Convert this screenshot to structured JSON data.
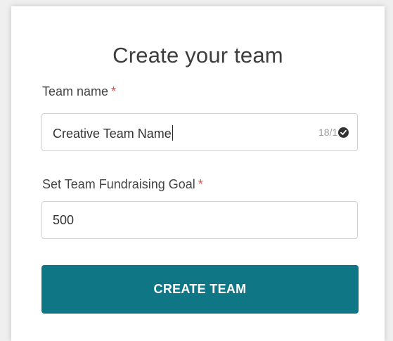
{
  "form": {
    "title": "Create your team",
    "team_name": {
      "label": "Team name",
      "required_marker": "*",
      "value": "Creative Team Name",
      "counter": "18/1",
      "status_icon": "check-circle-icon"
    },
    "goal": {
      "label": "Set Team Fundraising Goal",
      "required_marker": "*",
      "value": "500"
    },
    "submit_label": "CREATE TEAM"
  },
  "colors": {
    "button": "#0e7685",
    "required": "#e0483e",
    "page_background": "#efefef"
  }
}
